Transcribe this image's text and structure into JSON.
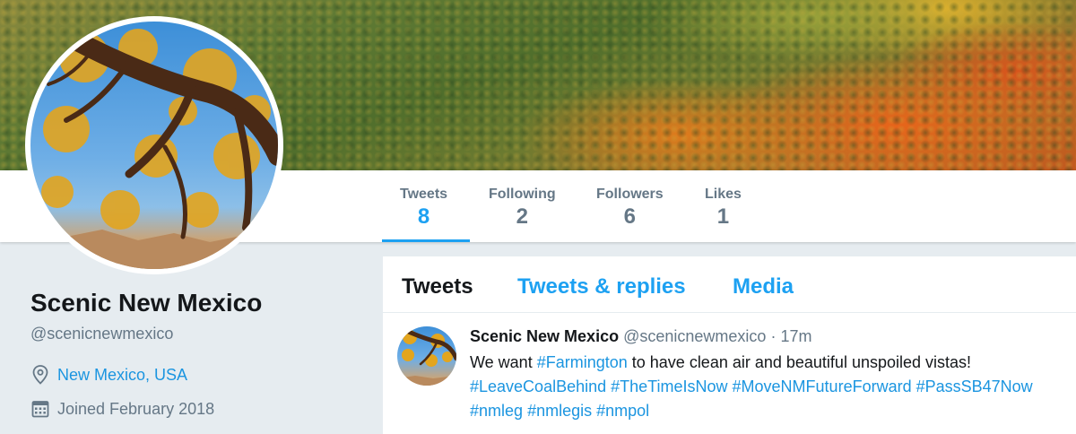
{
  "profile": {
    "name": "Scenic New Mexico",
    "handle": "@scenicnewmexico",
    "location": "New Mexico, USA",
    "joined": "Joined February 2018"
  },
  "stats": [
    {
      "label": "Tweets",
      "value": "8"
    },
    {
      "label": "Following",
      "value": "2"
    },
    {
      "label": "Followers",
      "value": "6"
    },
    {
      "label": "Likes",
      "value": "1"
    }
  ],
  "timeline": {
    "tabs": [
      "Tweets",
      "Tweets & replies",
      "Media"
    ],
    "tweet": {
      "name": "Scenic New Mexico",
      "handle": "@scenicnewmexico",
      "dot": "·",
      "time": "17m",
      "line1": {
        "pre": "We want ",
        "tag": "#Farmington",
        "post": " to have clean air and beautiful unspoiled vistas!"
      },
      "hashtags_line2": [
        "#LeaveCoalBehind",
        "#TheTimeIsNow",
        "#MoveNMFutureForward",
        "#PassSB47Now"
      ],
      "hashtags_line3": [
        "#nmleg",
        "#nmlegis",
        "#nmpol"
      ]
    }
  },
  "colors": {
    "accent": "#1da1f2",
    "link": "#1b95e0",
    "muted": "#657786",
    "text": "#14171a"
  },
  "icons": {
    "location": "map-pin-icon",
    "joined": "calendar-icon"
  }
}
